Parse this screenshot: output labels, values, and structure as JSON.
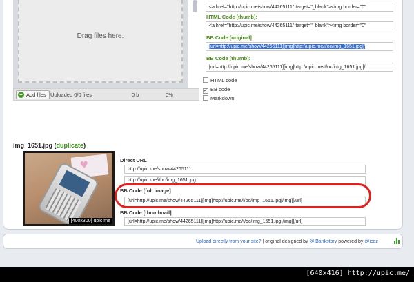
{
  "dropzone": {
    "text": "Drag files here."
  },
  "upload_bar": {
    "add_label": "Add files",
    "uploaded_text": "Uploaded 0/0 files",
    "size_text": "0 b",
    "percent_text": "0%"
  },
  "codes": [
    {
      "label": "",
      "value": "<a href=\"http://upic.me/show/44265111\" target=\"_blank\"><img border=\"0\"",
      "selected": false
    },
    {
      "label": "HTML Code [thumb]:",
      "value": "<a href=\"http://upic.me/show/44265111\" target=\"_blank\"><img border=\"0\"",
      "selected": false
    },
    {
      "label": "BB Code [original]:",
      "value": "[url=http://upic.me/show/44265111][img]http://upic.me/i/oc/img_1651.jpg[/",
      "selected": true
    },
    {
      "label": "BB Code [thumb]:",
      "value": "[url=http://upic.me/show/44265111][img]http://upic.me/t/oc/img_1651.jpg[/",
      "selected": false
    }
  ],
  "options": [
    {
      "label": "HTML code",
      "checked": false
    },
    {
      "label": "BB code",
      "checked": true
    },
    {
      "label": "Markdown",
      "checked": false
    }
  ],
  "file": {
    "name": "img_1651.jpg",
    "open_paren": "(",
    "duplicate": "duplicate",
    "close_paren": ")",
    "thumb_caption": "[400x300] upic.me"
  },
  "results": {
    "direct_url_label": "Direct URL",
    "direct_url_1": "http://upic.me/show/44265111",
    "direct_url_2": "http://upic.me/i/oc/img_1651.jpg",
    "full_image_label": "BB Code [full image]",
    "full_image_value": "[url=http://upic.me/show/44265111][img]http://upic.me/i/oc/img_1651.jpg[/img][/url]",
    "thumbnail_label": "BB Code [thumbnail]",
    "thumbnail_value": "[url=http://upic.me/show/44265111][img]http://upic.me/t/oc/img_1651.jpg[/img][/url]"
  },
  "footer": {
    "upload_link": "Upload directly from your site?",
    "sep": " | original designed by ",
    "designer": "@iBankstory",
    "powered": " powered by ",
    "powered_by": "@icez"
  },
  "watermark": "[640x416] http://upic.me/",
  "colors": {
    "accent_green": "#4a8a1a",
    "highlight_red": "#e0211d",
    "link_blue": "#2a62b8"
  }
}
